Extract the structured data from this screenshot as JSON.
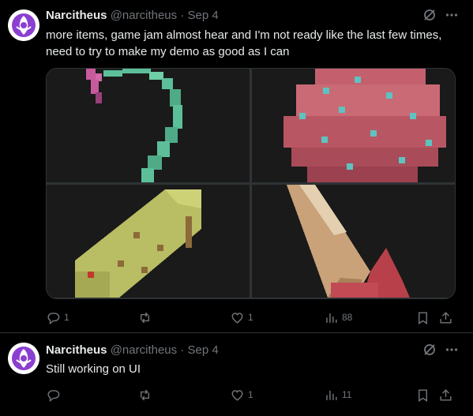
{
  "posts": [
    {
      "author_name": "Narcitheus",
      "handle": "@narcitheus",
      "separator": "·",
      "date": "Sep 4",
      "text_line1": "more items, game jam almost hear and I'm not ready like the last few times,",
      "text_line2": "need to try to make my demo as good as I can",
      "media_tiles": [
        "vine-item",
        "speckled-orb-item",
        "log-item",
        "horn-item"
      ],
      "stats": {
        "replies": "1",
        "reposts": "",
        "likes": "1",
        "views": "88"
      }
    },
    {
      "author_name": "Narcitheus",
      "handle": "@narcitheus",
      "separator": "·",
      "date": "Sep 4",
      "text_line1": "Still working on UI",
      "stats": {
        "replies": "",
        "reposts": "",
        "likes": "1",
        "views": "11"
      }
    }
  ],
  "icons": {
    "grok": "grok-icon",
    "more": "more-icon",
    "reply": "reply-icon",
    "repost": "repost-icon",
    "like": "like-icon",
    "views": "views-icon",
    "bookmark": "bookmark-icon",
    "share": "share-icon"
  },
  "colors": {
    "background": "#000000",
    "text": "#e7e9ea",
    "muted": "#71767b",
    "border": "#2f3336",
    "avatar_accent": "#8b3fd1"
  }
}
